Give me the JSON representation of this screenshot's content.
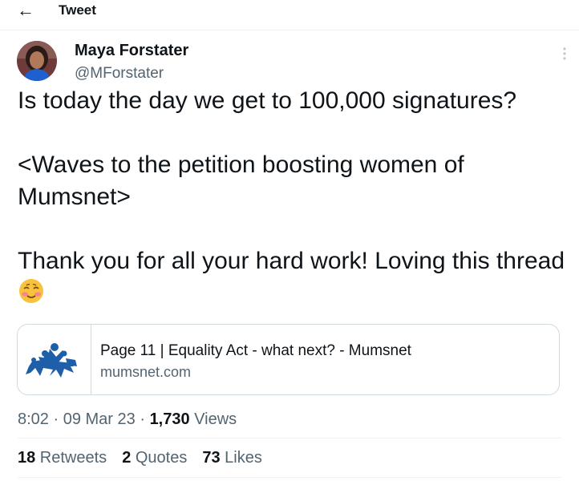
{
  "header": {
    "back_icon": "arrow-left-icon",
    "title": "Tweet"
  },
  "author": {
    "name": "Maya Forstater",
    "handle": "@MForstater",
    "avatar": "profile-photo"
  },
  "tweet": {
    "paragraphs": [
      "Is today the day we get to 100,000 signatures?",
      "<Waves to the petition boosting women of Mumsnet>",
      "Thank you for all your hard work! Loving this thread"
    ],
    "emoji": "smiling-face-with-blush"
  },
  "link_card": {
    "title": "Page 11 | Equality Act - what next? - Mumsnet",
    "domain": "mumsnet.com",
    "thumbnail": "mumsnet-logo"
  },
  "meta": {
    "time": "8:02",
    "separator": " · ",
    "date": "09 Mar 23",
    "views_count": "1,730",
    "views_label": " Views"
  },
  "stats": {
    "retweets_count": "18",
    "retweets_label": " Retweets",
    "quotes_count": "2",
    "quotes_label": " Quotes",
    "likes_count": "73",
    "likes_label": " Likes"
  },
  "colors": {
    "text": "#0f1419",
    "secondary": "#536471",
    "border": "#cfd9de",
    "mumsnet_blue": "#1f5ea8"
  }
}
